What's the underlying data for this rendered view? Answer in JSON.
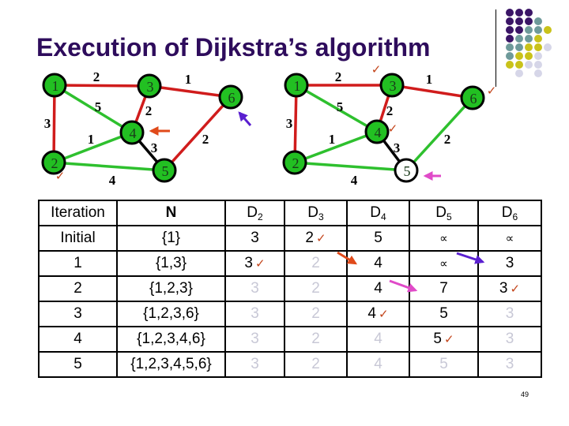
{
  "slide": {
    "title": "Execution of Dijkstra’s algorithm",
    "page_number": "49"
  },
  "colors": {
    "title": "#2e0c5c",
    "node_fill": "#22c022",
    "edge_red": "#d01c1c",
    "edge_green": "#2ec02e",
    "edge_black": "#000000",
    "check": "#c3441a",
    "arrow_orange": "#e04a1a",
    "arrow_purple": "#5a1fd0",
    "arrow_pink": "#e04ac8",
    "faded_text": "#c8c8d6",
    "dot_purple": "#3a1466",
    "dot_teal": "#6e9a9a",
    "dot_yellow": "#c9c21a",
    "dot_lavender": "#d6d6e8"
  },
  "decor_dots": [
    [
      "P",
      "P",
      "P",
      "",
      ""
    ],
    [
      "P",
      "P",
      "P",
      "T",
      ""
    ],
    [
      "P",
      "P",
      "T",
      "T",
      "Y"
    ],
    [
      "P",
      "T",
      "T",
      "Y",
      ""
    ],
    [
      "T",
      "T",
      "Y",
      "Y",
      "L"
    ],
    [
      "T",
      "Y",
      "Y",
      "L",
      ""
    ],
    [
      "Y",
      "Y",
      "L",
      "L",
      ""
    ],
    [
      "",
      "L",
      "",
      "L",
      ""
    ]
  ],
  "graphs": [
    {
      "name": "graph-left",
      "nodes": [
        {
          "id": "1",
          "status": "visited"
        },
        {
          "id": "2",
          "status": "visited"
        },
        {
          "id": "3",
          "status": "visited"
        },
        {
          "id": "4",
          "status": "visited"
        },
        {
          "id": "5",
          "status": "visited"
        },
        {
          "id": "6",
          "status": "visited"
        }
      ],
      "edges": [
        {
          "from": "1",
          "to": "3",
          "weight": "2",
          "color": "red"
        },
        {
          "from": "3",
          "to": "6",
          "weight": "1",
          "color": "red"
        },
        {
          "from": "1",
          "to": "2",
          "weight": "3",
          "color": "red"
        },
        {
          "from": "3",
          "to": "4",
          "weight": "2",
          "color": "red"
        },
        {
          "from": "1",
          "to": "4",
          "weight": "5",
          "color": "green"
        },
        {
          "from": "2",
          "to": "4",
          "weight": "1",
          "color": "green"
        },
        {
          "from": "2",
          "to": "5",
          "weight": "4",
          "color": "green"
        },
        {
          "from": "4",
          "to": "5",
          "weight": "3",
          "color": "black"
        },
        {
          "from": "5",
          "to": "6",
          "weight": "2",
          "color": "red"
        }
      ],
      "checks": [
        "2"
      ],
      "arrows": [
        {
          "target": "4",
          "color": "orange"
        },
        {
          "target": "6",
          "color": "purple"
        }
      ]
    },
    {
      "name": "graph-right",
      "nodes": [
        {
          "id": "1",
          "status": "visited"
        },
        {
          "id": "2",
          "status": "visited"
        },
        {
          "id": "3",
          "status": "visited"
        },
        {
          "id": "4",
          "status": "visited"
        },
        {
          "id": "5",
          "status": "unvisited"
        },
        {
          "id": "6",
          "status": "visited"
        }
      ],
      "edges": [
        {
          "from": "1",
          "to": "3",
          "weight": "2",
          "color": "red"
        },
        {
          "from": "3",
          "to": "6",
          "weight": "1",
          "color": "red"
        },
        {
          "from": "1",
          "to": "2",
          "weight": "3",
          "color": "red"
        },
        {
          "from": "3",
          "to": "4",
          "weight": "2",
          "color": "red"
        },
        {
          "from": "1",
          "to": "4",
          "weight": "5",
          "color": "green"
        },
        {
          "from": "2",
          "to": "4",
          "weight": "1",
          "color": "green"
        },
        {
          "from": "2",
          "to": "5",
          "weight": "4",
          "color": "green"
        },
        {
          "from": "4",
          "to": "5",
          "weight": "3",
          "color": "black"
        },
        {
          "from": "5",
          "to": "6",
          "weight": "2",
          "color": "green"
        }
      ],
      "checks": [
        "3",
        "4",
        "6"
      ],
      "arrows": [
        {
          "target": "5",
          "color": "pink"
        }
      ]
    }
  ],
  "table": {
    "headers": [
      {
        "text": "Iteration",
        "sub": ""
      },
      {
        "text": "N",
        "sub": ""
      },
      {
        "text": "D",
        "sub": "2"
      },
      {
        "text": "D",
        "sub": "3"
      },
      {
        "text": "D",
        "sub": "4"
      },
      {
        "text": "D",
        "sub": "5"
      },
      {
        "text": "D",
        "sub": "6"
      }
    ],
    "rows": [
      {
        "iteration": "Initial",
        "n": "{1}",
        "cells": [
          {
            "v": "3",
            "faded": false,
            "check": false
          },
          {
            "v": "2",
            "faded": false,
            "check": true
          },
          {
            "v": "5",
            "faded": false,
            "check": false
          },
          {
            "v": "∝",
            "faded": false,
            "check": false
          },
          {
            "v": "∝",
            "faded": false,
            "check": false
          }
        ]
      },
      {
        "iteration": "1",
        "n": "{1,3}",
        "cells": [
          {
            "v": "3",
            "faded": false,
            "check": true
          },
          {
            "v": "2",
            "faded": true,
            "check": false
          },
          {
            "v": "4",
            "faded": false,
            "check": false
          },
          {
            "v": "∝",
            "faded": false,
            "check": false
          },
          {
            "v": "3",
            "faded": false,
            "check": false
          }
        ]
      },
      {
        "iteration": "2",
        "n": "{1,2,3}",
        "cells": [
          {
            "v": "3",
            "faded": true,
            "check": false
          },
          {
            "v": "2",
            "faded": true,
            "check": false
          },
          {
            "v": "4",
            "faded": false,
            "check": false
          },
          {
            "v": "7",
            "faded": false,
            "check": false
          },
          {
            "v": "3",
            "faded": false,
            "check": true
          }
        ]
      },
      {
        "iteration": "3",
        "n": "{1,2,3,6}",
        "cells": [
          {
            "v": "3",
            "faded": true,
            "check": false
          },
          {
            "v": "2",
            "faded": true,
            "check": false
          },
          {
            "v": "4",
            "faded": false,
            "check": true
          },
          {
            "v": "5",
            "faded": false,
            "check": false
          },
          {
            "v": "3",
            "faded": true,
            "check": false
          }
        ]
      },
      {
        "iteration": "4",
        "n": "{1,2,3,4,6}",
        "cells": [
          {
            "v": "3",
            "faded": true,
            "check": false
          },
          {
            "v": "2",
            "faded": true,
            "check": false
          },
          {
            "v": "4",
            "faded": true,
            "check": false
          },
          {
            "v": "5",
            "faded": false,
            "check": true
          },
          {
            "v": "3",
            "faded": true,
            "check": false
          }
        ]
      },
      {
        "iteration": "5",
        "n": "{1,2,3,4,5,6}",
        "cells": [
          {
            "v": "3",
            "faded": true,
            "check": false
          },
          {
            "v": "2",
            "faded": true,
            "check": false
          },
          {
            "v": "4",
            "faded": true,
            "check": false
          },
          {
            "v": "5",
            "faded": true,
            "check": false
          },
          {
            "v": "3",
            "faded": true,
            "check": false
          }
        ]
      }
    ],
    "check_glyph": "✓",
    "update_arrows": [
      {
        "row": "1",
        "column": "D4",
        "color": "orange"
      },
      {
        "row": "1",
        "column": "D6",
        "color": "purple"
      },
      {
        "row": "2",
        "column": "D5",
        "color": "pink"
      }
    ]
  }
}
